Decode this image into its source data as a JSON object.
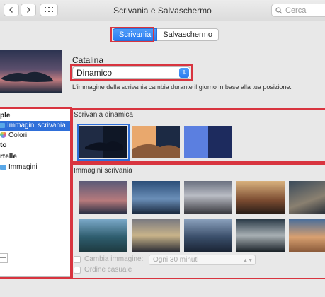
{
  "window": {
    "title": "Scrivania e Salvaschermo",
    "search_placeholder": "Cerca"
  },
  "tabs": [
    {
      "label": "Scrivania",
      "active": true
    },
    {
      "label": "Salvaschermo",
      "active": false
    }
  ],
  "current": {
    "name": "Catalina",
    "mode": "Dinamico",
    "description": "L'immagine della scrivania cambia durante il giorno in base alla tua posizione."
  },
  "sidebar": {
    "items": [
      {
        "label": "ple",
        "kind": "group"
      },
      {
        "label": "Immagini scrivania",
        "kind": "folder",
        "selected": true
      },
      {
        "label": "Colori",
        "kind": "colors"
      },
      {
        "label": "to",
        "kind": "group"
      },
      {
        "label": "rtelle",
        "kind": "group"
      },
      {
        "label": "Immagini",
        "kind": "folder"
      }
    ],
    "minus_label": "—"
  },
  "sections": {
    "dynamic_title": "Scrivania dinamica",
    "images_title": "Immagini scrivania"
  },
  "options": {
    "change_picture_label": "Cambia immagine:",
    "interval_value": "Ogni 30 minuti",
    "random_order_label": "Ordine casuale"
  },
  "colors": {
    "accent": "#2f6fd9",
    "highlight_box": "#d8343f"
  }
}
